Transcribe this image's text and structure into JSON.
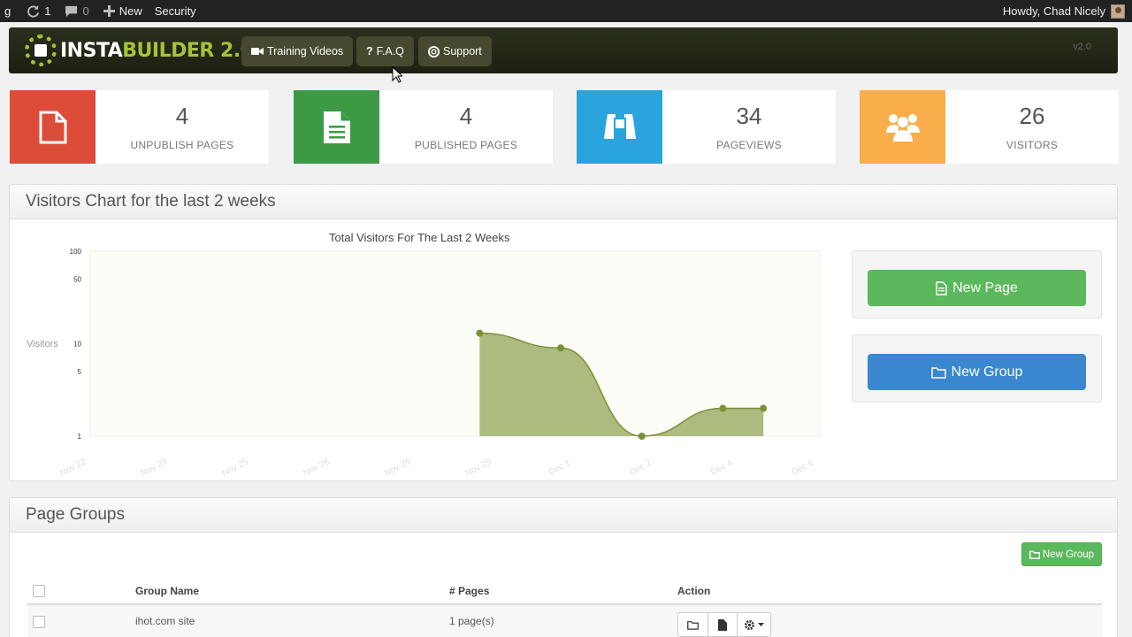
{
  "adminbar": {
    "site_fragment": "g",
    "updates_count": "1",
    "comments_count": "0",
    "new_label": "New",
    "security_label": "Security",
    "howdy_text": "Howdy, Chad Nicely"
  },
  "header": {
    "logo_part1": "INSTA",
    "logo_part2": "BUILDER 2.0",
    "nav": [
      "Training Videos",
      "F.A.Q",
      "Support"
    ],
    "version": "v2.0"
  },
  "stats": [
    {
      "value": "4",
      "label": "UNPUBLISH PAGES",
      "color": "#dd4b39",
      "icon": "file-icon"
    },
    {
      "value": "4",
      "label": "PUBLISHED PAGES",
      "color": "#3c9a44",
      "icon": "file-text-icon"
    },
    {
      "value": "34",
      "label": "PAGEVIEWS",
      "color": "#2aa4dc",
      "icon": "binoculars-icon"
    },
    {
      "value": "26",
      "label": "VISITORS",
      "color": "#f9ae4b",
      "icon": "users-icon"
    }
  ],
  "visitors_panel": {
    "heading": "Visitors Chart for the last 2 weeks",
    "new_page_label": "New Page",
    "new_group_label": "New Group"
  },
  "chart_data": {
    "type": "area",
    "title": "Total Visitors For The Last 2 Weeks",
    "ylabel": "Visitors",
    "xlabel": "",
    "yscale": "log",
    "ylim": [
      1,
      100
    ],
    "yticks": [
      "100",
      "50",
      "10",
      "5",
      "1"
    ],
    "x_tick_labels": [
      "Nov 22",
      "Nov 23",
      "Nov 25",
      "Nov 26",
      "Nov 28",
      "Nov 29",
      "Dec 1",
      "Dec 2",
      "Dec 4",
      "Dec 6"
    ],
    "points": [
      {
        "x": "Nov 29",
        "y": 13
      },
      {
        "x": "Dec 1",
        "y": 9
      },
      {
        "x": "Dec 2",
        "y": 1
      },
      {
        "x": "Dec 4",
        "y": 2
      },
      {
        "x": "Dec 5",
        "y": 2
      }
    ],
    "series_color": "#8a9e4a",
    "grid": false
  },
  "groups_panel": {
    "heading": "Page Groups",
    "new_group_label": "New Group",
    "columns": [
      "Group Name",
      "# Pages",
      "Action"
    ],
    "rows": [
      {
        "name": "ihot.com site",
        "pages": "1 page(s)"
      }
    ]
  }
}
